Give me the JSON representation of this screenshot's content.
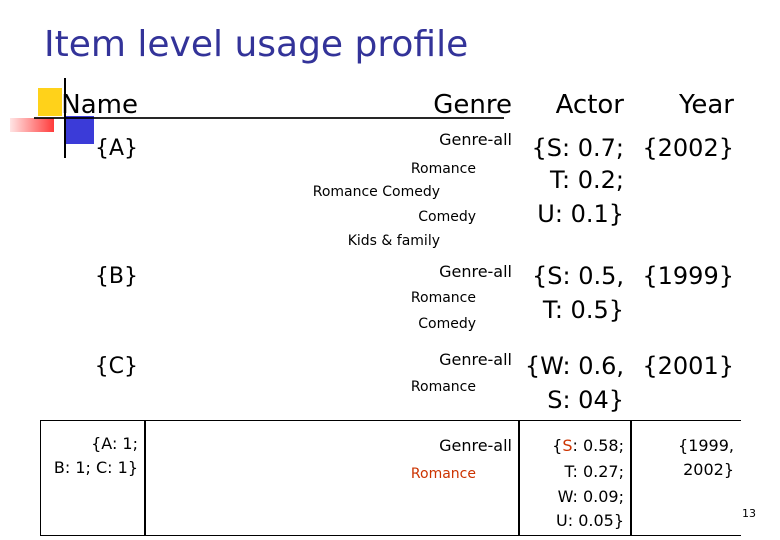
{
  "slide": {
    "title": "Item level usage profile",
    "page_number": "13"
  },
  "table": {
    "headers": {
      "name": "Name",
      "genre": "Genre",
      "actor": "Actor",
      "year": "Year"
    },
    "rows": [
      {
        "name": "{A}",
        "genre": [
          "Genre-all",
          "Romance",
          "Romance Comedy",
          "Comedy",
          "Kids & family"
        ],
        "actor": [
          "{S: 0.7;",
          "T: 0.2;",
          "U: 0.1}"
        ],
        "year": "{2002}"
      },
      {
        "name": "{B}",
        "genre": [
          "Genre-all",
          "Romance",
          "Comedy"
        ],
        "actor": [
          "{S: 0.5,",
          "T: 0.5}"
        ],
        "year": "{1999}"
      },
      {
        "name": "{C}",
        "genre": [
          "Genre-all",
          "Romance"
        ],
        "actor": [
          "{W: 0.6,",
          "S: 04}"
        ],
        "year": "{2001}"
      },
      {
        "name": [
          "{A: 1;",
          "B: 1; C: 1}"
        ],
        "genre": [
          "Genre-all",
          "Romance"
        ],
        "actor": [
          "{",
          "S",
          ": 0.58;",
          "T: 0.27;",
          "W: 0.09;",
          "U: 0.05}"
        ],
        "year": [
          "{1999,",
          "2002}"
        ]
      }
    ]
  },
  "colors": {
    "title": "#333399",
    "highlight": "#cc3300"
  }
}
